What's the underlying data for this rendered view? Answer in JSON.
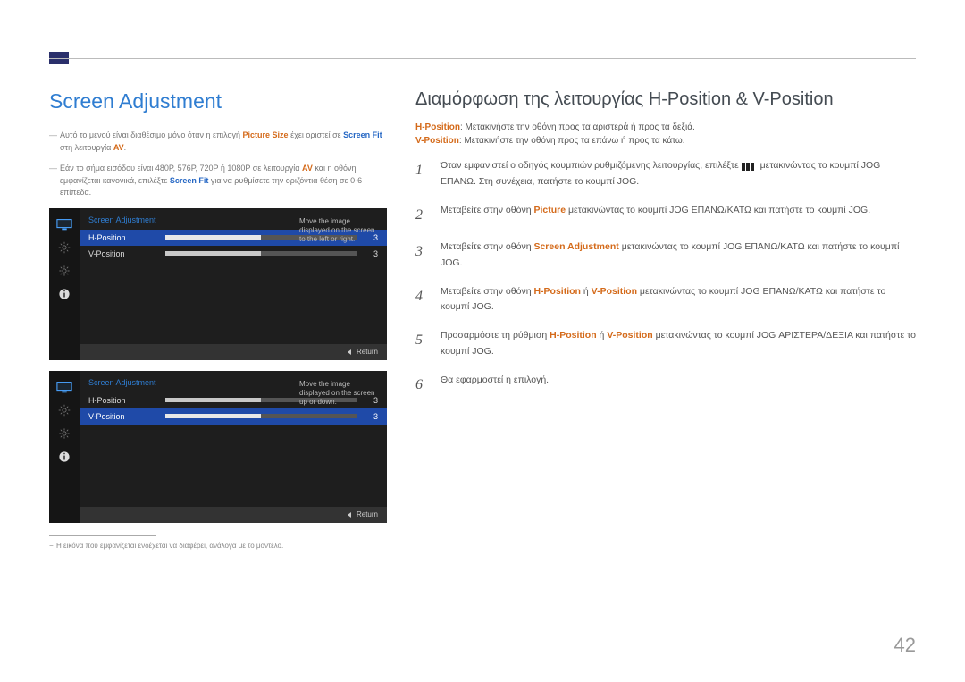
{
  "page_number": "42",
  "left": {
    "title": "Screen Adjustment",
    "notes": [
      {
        "pre": "Αυτό το μενού είναι διαθέσιμο μόνο όταν η επιλογή ",
        "hl1": "Picture Size",
        "mid1": " έχει οριστεί σε ",
        "bl1": "Screen Fit",
        "mid2": " στη λειτουργία ",
        "hl2": "AV",
        "post": "."
      },
      {
        "pre": "Εάν το σήμα εισόδου είναι 480P, 576P,  720P ή 1080P σε λειτουργία ",
        "hl1": "AV",
        "mid1": " και η οθόνη εμφανίζεται κανονικά, επιλέξτε ",
        "bl1": "Screen Fit",
        "post": " για να ρυθμίσετε την οριζόντια θέση σε 0-6 επίπεδα."
      }
    ],
    "footnote": "Η εικόνα που εμφανίζεται ενδέχεται να διαφέρει, ανάλογα με το μοντέλο."
  },
  "osd": {
    "header": "Screen Adjustment",
    "return": "Return",
    "panels": [
      {
        "desc": "Move the image displayed on the screen to the left or right.",
        "rows": [
          {
            "label": "H-Position",
            "value": "3",
            "fill": 50,
            "selected": true
          },
          {
            "label": "V-Position",
            "value": "3",
            "fill": 50,
            "selected": false
          }
        ]
      },
      {
        "desc": "Move the image displayed on the screen up or down.",
        "rows": [
          {
            "label": "H-Position",
            "value": "3",
            "fill": 50,
            "selected": false
          },
          {
            "label": "V-Position",
            "value": "3",
            "fill": 50,
            "selected": true
          }
        ]
      }
    ]
  },
  "right": {
    "title": "Διαμόρφωση της λειτουργίας H-Position & V-Position",
    "intro": [
      {
        "hl": "H-Position",
        "txt": ": Μετακινήστε την οθόνη προς τα αριστερά ή προς τα δεξιά."
      },
      {
        "hl": "V-Position",
        "txt": ": Μετακινήστε την οθόνη προς τα επάνω ή προς τα κάτω."
      }
    ],
    "steps": [
      {
        "n": "1",
        "pre": "Όταν εμφανιστεί ο οδηγός κουμπιών ρυθμιζόμενης λειτουργίας, επιλέξτε ",
        "icon": true,
        "post": " μετακινώντας το κουμπί JOG ΕΠΑΝΩ. Στη συνέχεια, πατήστε το κουμπί JOG."
      },
      {
        "n": "2",
        "pre": "Μεταβείτε στην οθόνη ",
        "hl": "Picture",
        "post": " μετακινώντας το κουμπί JOG ΕΠΑΝΩ/ΚΑΤΩ και πατήστε το κουμπί JOG."
      },
      {
        "n": "3",
        "pre": "Μεταβείτε στην οθόνη ",
        "hl": "Screen Adjustment",
        "post": " μετακινώντας το κουμπί JOG ΕΠΑΝΩ/ΚΑΤΩ και πατήστε το κουμπί JOG."
      },
      {
        "n": "4",
        "pre": "Μεταβείτε στην οθόνη ",
        "hl": "H-Position",
        "mid": " ή ",
        "hl2": "V-Position",
        "post": " μετακινώντας το κουμπί JOG ΕΠΑΝΩ/ΚΑΤΩ και πατήστε το κουμπί JOG."
      },
      {
        "n": "5",
        "pre": "Προσαρμόστε τη ρύθμιση ",
        "hl": "H-Position",
        "mid": " ή ",
        "hl2": "V-Position",
        "post": " μετακινώντας το κουμπί JOG ΑΡΙΣΤΕΡΑ/ΔΕΞΙΑ και πατήστε το κουμπί JOG."
      },
      {
        "n": "6",
        "pre": "Θα εφαρμοστεί η επιλογή."
      }
    ]
  }
}
